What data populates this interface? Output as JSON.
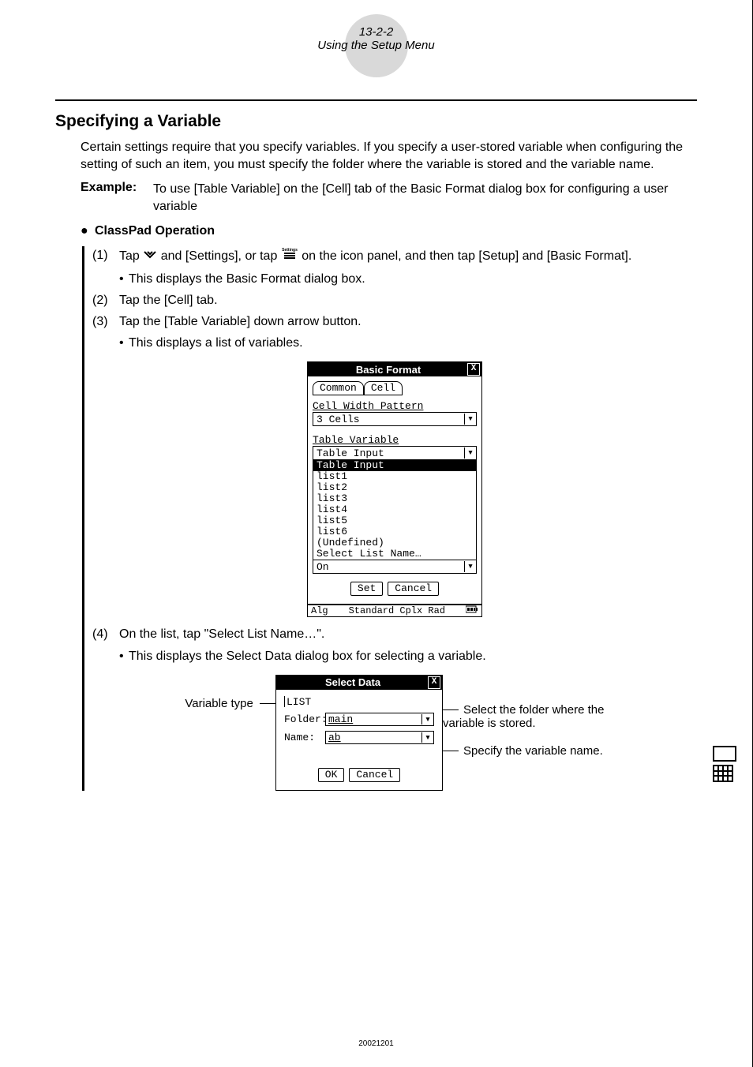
{
  "pageBadge": {
    "num": "13-2-2",
    "title": "Using the Setup Menu"
  },
  "section": "Specifying a Variable",
  "intro": "Certain settings require that you specify variables. If you specify a user-stored variable when configuring the setting of such an item, you must specify the folder where the variable is stored and the variable name.",
  "example": {
    "label": "Example:",
    "text": "To use [Table Variable] on the [Cell] tab of the Basic Format dialog box for configuring a user variable"
  },
  "opHead": "ClassPad Operation",
  "steps": {
    "s1a": "(1)",
    "s1_pre": "Tap ",
    "s1_mid": " and [Settings], or tap ",
    "s1_post": " on the icon panel, and then tap [Setup] and [Basic Format].",
    "s1_sub": "This displays the Basic Format dialog box.",
    "s2a": "(2)",
    "s2": "Tap the [Cell] tab.",
    "s3a": "(3)",
    "s3": "Tap the [Table Variable] down arrow button.",
    "s3_sub": "This displays a list of variables.",
    "s4a": "(4)",
    "s4": "On the list, tap \"Select List Name…\".",
    "s4_sub": "This displays the Select Data dialog box for selecting a variable."
  },
  "bf": {
    "title": "Basic Format",
    "tab1": "Common",
    "tab2": "Cell",
    "label_cwp": "Cell Width Pattern",
    "val_cwp": "3 Cells",
    "label_tv": "Table Variable",
    "val_tv": "Table Input",
    "list": [
      "Table Input",
      "list1",
      "list2",
      "list3",
      "list4",
      "list5",
      "list6",
      "(Undefined)",
      "Select List Name…"
    ],
    "below_val": "On",
    "btn_set": "Set",
    "btn_cancel": "Cancel",
    "status_left": "Alg",
    "status_mid": "Standard Cplx Rad"
  },
  "sd": {
    "title": "Select Data",
    "vtype": "LIST",
    "folder_label": "Folder:",
    "folder_val": "main",
    "name_label": "Name:",
    "name_val": "ab",
    "btn_ok": "OK",
    "btn_cancel": "Cancel"
  },
  "annot": {
    "left": "Variable type",
    "right1": "Select the folder where the variable is stored.",
    "right2": "Specify the variable name."
  },
  "footer": "20021201"
}
